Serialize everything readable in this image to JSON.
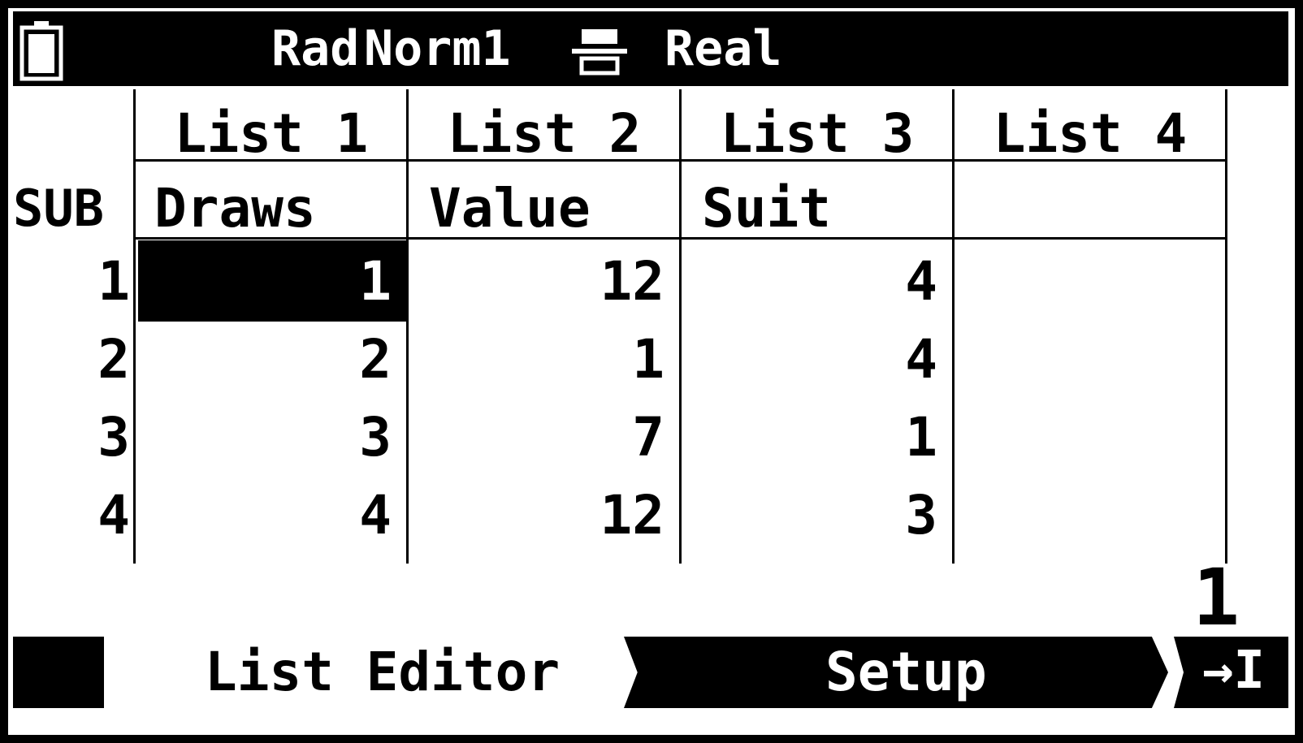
{
  "status": {
    "angle": "Rad",
    "display": "Norm1",
    "complex": "Real"
  },
  "table": {
    "subLabel": "SUB",
    "headers": [
      "List 1",
      "List 2",
      "List 3",
      "List 4"
    ],
    "subnames": [
      "Draws",
      "Value",
      "Suit",
      ""
    ],
    "rowNumbers": [
      "1",
      "2",
      "3",
      "4"
    ],
    "rows": [
      [
        "1",
        "12",
        "4",
        ""
      ],
      [
        "2",
        "1",
        "4",
        ""
      ],
      [
        "3",
        "7",
        "1",
        ""
      ],
      [
        "4",
        "12",
        "3",
        ""
      ]
    ]
  },
  "readout": "1",
  "fkeys": {
    "list_editor": "List Editor",
    "setup": "Setup",
    "more": "→I"
  }
}
